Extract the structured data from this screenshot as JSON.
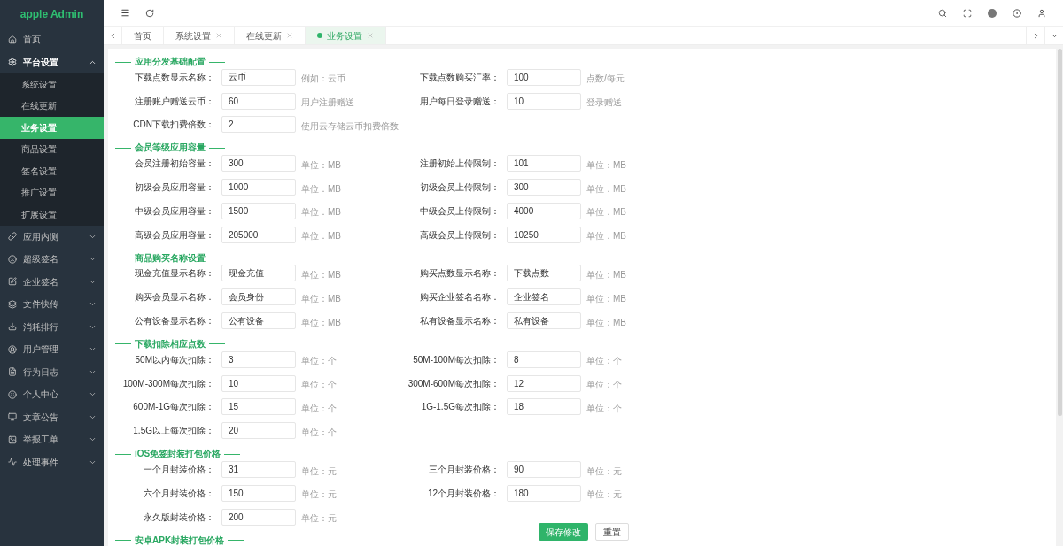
{
  "sidebar": {
    "logo": "apple Admin",
    "items": [
      {
        "kind": "link",
        "label": "首页"
      },
      {
        "kind": "menu",
        "label": "平台设置",
        "expanded": true,
        "children": [
          {
            "label": "系统设置",
            "selected": false
          },
          {
            "label": "在线更新",
            "selected": false
          },
          {
            "label": "业务设置",
            "selected": true
          },
          {
            "label": "商品设置",
            "selected": false
          },
          {
            "label": "签名设置",
            "selected": false
          },
          {
            "label": "推广设置",
            "selected": false
          },
          {
            "label": "扩展设置",
            "selected": false
          }
        ]
      },
      {
        "kind": "menu",
        "label": "应用内测",
        "expanded": false
      },
      {
        "kind": "menu",
        "label": "超级签名",
        "expanded": false
      },
      {
        "kind": "menu",
        "label": "企业签名",
        "expanded": false
      },
      {
        "kind": "menu",
        "label": "文件快传",
        "expanded": false
      },
      {
        "kind": "menu",
        "label": "消耗排行",
        "expanded": false
      },
      {
        "kind": "menu",
        "label": "用户管理",
        "expanded": false
      },
      {
        "kind": "menu",
        "label": "行为日志",
        "expanded": false
      },
      {
        "kind": "menu",
        "label": "个人中心",
        "expanded": false
      },
      {
        "kind": "menu",
        "label": "文章公告",
        "expanded": false
      },
      {
        "kind": "menu",
        "label": "举报工单",
        "expanded": false
      },
      {
        "kind": "menu",
        "label": "处理事件",
        "expanded": false
      }
    ]
  },
  "tabs": [
    {
      "label": "首页",
      "selected": false,
      "closable": false
    },
    {
      "label": "系统设置",
      "selected": false,
      "closable": true
    },
    {
      "label": "在线更新",
      "selected": false,
      "closable": true
    },
    {
      "label": "业务设置",
      "selected": true,
      "closable": true
    }
  ],
  "form": {
    "sections": [
      {
        "title": "应用分发基础配置",
        "rows": [
          {
            "fields": [
              {
                "label": "下载点数显示名称：",
                "value": "云币",
                "hint": "例如：云币"
              },
              {
                "label": "下载点数购买汇率：",
                "value": "100",
                "hint": "点数/每元"
              }
            ]
          },
          {
            "fields": [
              {
                "label": "注册账户赠送云币：",
                "value": "60",
                "hint": "用户注册赠送"
              },
              {
                "label": "用户每日登录赠送：",
                "value": "10",
                "hint": "登录赠送"
              }
            ]
          },
          {
            "fields": [
              {
                "label": "CDN下载扣费倍数：",
                "value": "2",
                "hint": "使用云存储云币扣费倍数"
              }
            ]
          }
        ]
      },
      {
        "title": "会员等级应用容量",
        "rows": [
          {
            "fields": [
              {
                "label": "会员注册初始容量：",
                "value": "300",
                "hint": "单位：MB"
              },
              {
                "label": "注册初始上传限制：",
                "value": "101",
                "hint": "单位：MB"
              }
            ]
          },
          {
            "fields": [
              {
                "label": "初级会员应用容量：",
                "value": "1000",
                "hint": "单位：MB"
              },
              {
                "label": "初级会员上传限制：",
                "value": "300",
                "hint": "单位：MB"
              }
            ]
          },
          {
            "fields": [
              {
                "label": "中级会员应用容量：",
                "value": "1500",
                "hint": "单位：MB"
              },
              {
                "label": "中级会员上传限制：",
                "value": "4000",
                "hint": "单位：MB"
              }
            ]
          },
          {
            "fields": [
              {
                "label": "高级会员应用容量：",
                "value": "205000",
                "hint": "单位：MB"
              },
              {
                "label": "高级会员上传限制：",
                "value": "10250",
                "hint": "单位：MB"
              }
            ]
          }
        ]
      },
      {
        "title": "商品购买名称设置",
        "rows": [
          {
            "fields": [
              {
                "label": "现金充值显示名称：",
                "value": "现金充值",
                "hint": "单位：MB"
              },
              {
                "label": "购买点数显示名称：",
                "value": "下载点数",
                "hint": "单位：MB"
              }
            ]
          },
          {
            "fields": [
              {
                "label": "购买会员显示名称：",
                "value": "会员身份",
                "hint": "单位：MB"
              },
              {
                "label": "购买企业签名名称：",
                "value": "企业签名",
                "hint": "单位：MB"
              }
            ]
          },
          {
            "fields": [
              {
                "label": "公有设备显示名称：",
                "value": "公有设备",
                "hint": "单位：MB"
              },
              {
                "label": "私有设备显示名称：",
                "value": "私有设备",
                "hint": "单位：MB"
              }
            ]
          }
        ]
      },
      {
        "title": "下载扣除相应点数",
        "rows": [
          {
            "fields": [
              {
                "label": "50M以内每次扣除：",
                "value": "3",
                "hint": "单位：个"
              },
              {
                "label": "50M-100M每次扣除：",
                "value": "8",
                "hint": "单位：个"
              }
            ]
          },
          {
            "fields": [
              {
                "label": "100M-300M每次扣除：",
                "value": "10",
                "hint": "单位：个"
              },
              {
                "label": "300M-600M每次扣除：",
                "value": "12",
                "hint": "单位：个"
              }
            ]
          },
          {
            "fields": [
              {
                "label": "600M-1G每次扣除：",
                "value": "15",
                "hint": "单位：个"
              },
              {
                "label": "1G-1.5G每次扣除：",
                "value": "18",
                "hint": "单位：个"
              }
            ]
          },
          {
            "fields": [
              {
                "label": "1.5G以上每次扣除：",
                "value": "20",
                "hint": "单位：个"
              }
            ]
          }
        ]
      },
      {
        "title": "iOS免签封装打包价格",
        "rows": [
          {
            "fields": [
              {
                "label": "一个月封装价格：",
                "value": "31",
                "hint": "单位：元"
              },
              {
                "label": "三个月封装价格：",
                "value": "90",
                "hint": "单位：元"
              }
            ]
          },
          {
            "fields": [
              {
                "label": "六个月封装价格：",
                "value": "150",
                "hint": "单位：元"
              },
              {
                "label": "12个月封装价格：",
                "value": "180",
                "hint": "单位：元"
              }
            ]
          },
          {
            "fields": [
              {
                "label": "永久版封装价格：",
                "value": "200",
                "hint": "单位：元"
              }
            ]
          }
        ]
      },
      {
        "title": "安卓APK封装打包价格"
      }
    ]
  },
  "footer": {
    "buttons": [
      {
        "label": "保存修改",
        "kind": "primary"
      },
      {
        "label": "重置",
        "kind": "secondary"
      }
    ]
  }
}
